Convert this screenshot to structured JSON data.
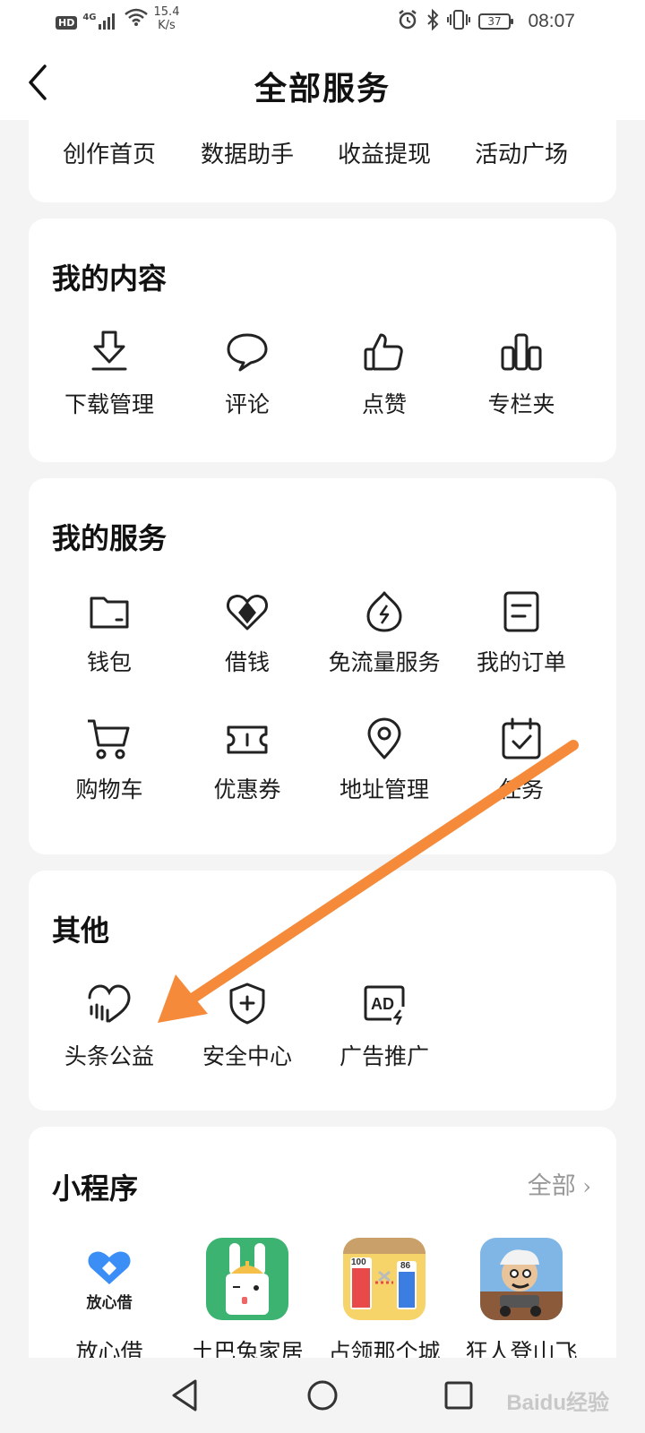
{
  "status_bar": {
    "hd": "HD",
    "signal": "4G",
    "speed_value": "15.4",
    "speed_unit": "K/s",
    "battery": "37",
    "time": "08:07"
  },
  "header": {
    "title": "全部服务"
  },
  "top_links": [
    "创作首页",
    "数据助手",
    "收益提现",
    "活动广场"
  ],
  "my_content": {
    "title": "我的内容",
    "items": [
      {
        "label": "下载管理",
        "icon": "download-icon"
      },
      {
        "label": "评论",
        "icon": "comment-icon"
      },
      {
        "label": "点赞",
        "icon": "thumbs-up-icon"
      },
      {
        "label": "专栏夹",
        "icon": "column-folder-icon"
      }
    ]
  },
  "my_services": {
    "title": "我的服务",
    "items": [
      {
        "label": "钱包",
        "icon": "wallet-icon"
      },
      {
        "label": "借钱",
        "icon": "borrow-icon"
      },
      {
        "label": "免流量服务",
        "icon": "data-free-icon"
      },
      {
        "label": "我的订单",
        "icon": "order-icon"
      },
      {
        "label": "购物车",
        "icon": "cart-icon"
      },
      {
        "label": "优惠券",
        "icon": "coupon-icon"
      },
      {
        "label": "地址管理",
        "icon": "location-icon"
      },
      {
        "label": "任务",
        "icon": "task-calendar-icon"
      }
    ]
  },
  "other": {
    "title": "其他",
    "items": [
      {
        "label": "头条公益",
        "icon": "charity-heart-icon"
      },
      {
        "label": "安全中心",
        "icon": "security-shield-icon"
      },
      {
        "label": "广告推广",
        "icon": "ad-icon"
      }
    ]
  },
  "mini_programs": {
    "title": "小程序",
    "all_label": "全部",
    "items": [
      {
        "label": "放心借",
        "logo_text": "放心借"
      },
      {
        "label": "土巴兔家居"
      },
      {
        "label": "占领那个城",
        "badge_left": "100",
        "badge_right": "86"
      },
      {
        "label": "狂人登山飞"
      }
    ]
  },
  "watermark": "Baidu经验",
  "colors": {
    "accent_arrow": "#f58b3a",
    "background": "#f4f4f4",
    "card": "#ffffff",
    "mini_green": "#3cb371",
    "mini_blue": "#3a8ef6"
  }
}
